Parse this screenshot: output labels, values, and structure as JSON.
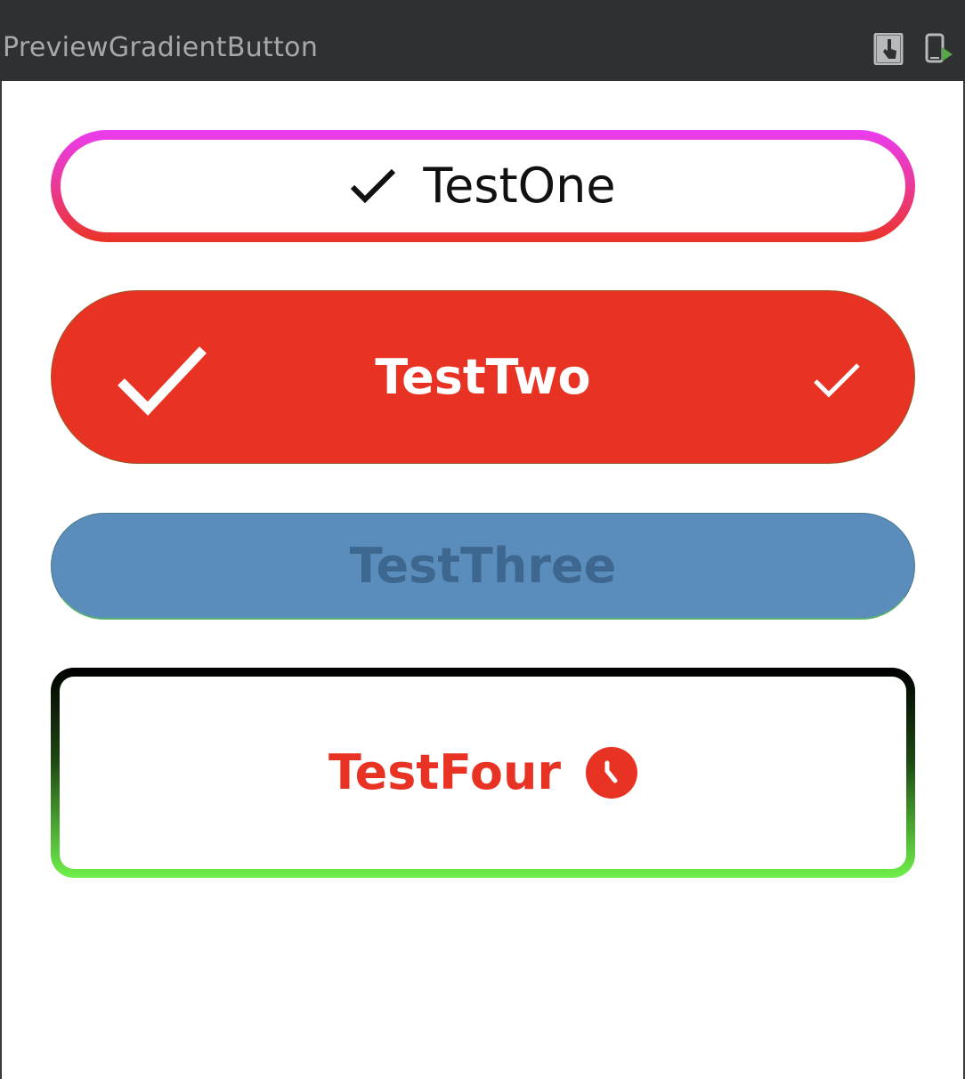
{
  "window": {
    "title": "PreviewGradientButton"
  },
  "toolbar": {
    "icons": [
      "interactive-mode-icon",
      "deploy-preview-icon"
    ]
  },
  "buttons": {
    "one": {
      "label": "TestOne",
      "icon": "check-icon",
      "gradient": [
        "#EA3CF0",
        "#EA3425"
      ]
    },
    "two": {
      "label": "TestTwo",
      "icons": [
        "check-icon",
        "check-icon"
      ],
      "color": "#E83324"
    },
    "three": {
      "label": "TestThree",
      "color": "#5A8CBC",
      "text_color": "#3E6790"
    },
    "four": {
      "label": "TestFour",
      "icon": "clock-icon",
      "text_color": "#E83324",
      "gradient": [
        "#000000",
        "#6EF04A"
      ]
    }
  }
}
